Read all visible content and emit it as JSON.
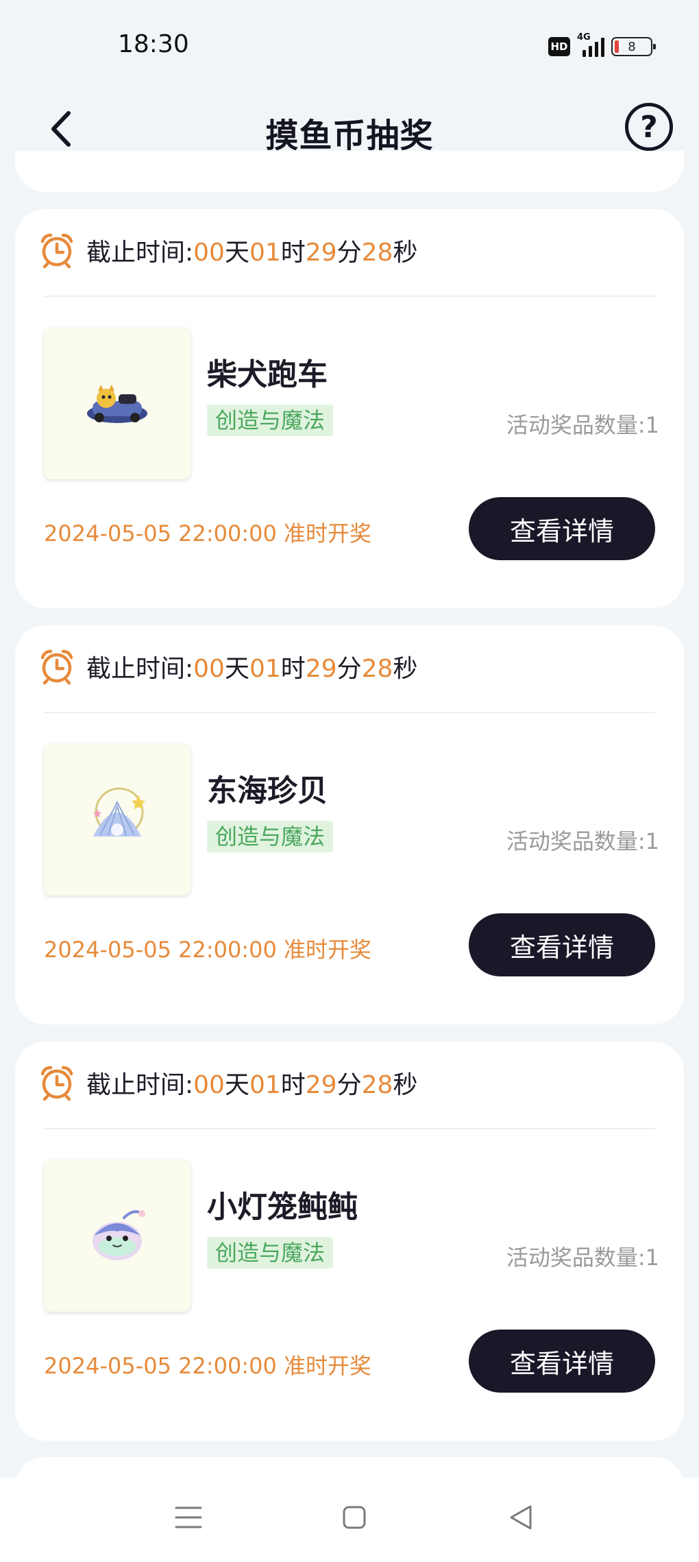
{
  "status_bar": {
    "time": "18:30",
    "hd_label": "HD",
    "network": "4G",
    "battery": "8"
  },
  "header": {
    "title": "摸鱼币抽奖",
    "back_icon": "chevron-left-icon",
    "help_icon": "question-circle-icon",
    "help_glyph": "?"
  },
  "colors": {
    "accent_orange": "#e68a3a",
    "button_dark": "#191828",
    "tag_green": "#4aa75c",
    "tag_bg": "#e0f3df"
  },
  "cards": [
    {
      "deadline_label": "截止时间:",
      "days": "00",
      "days_unit": "天",
      "hours": "01",
      "hours_unit": "时",
      "minutes": "29",
      "minutes_unit": "分",
      "seconds": "28",
      "seconds_unit": "秒",
      "prize_name": "柴犬跑车",
      "category": "创造与魔法",
      "prize_count": "活动奖品数量:1",
      "draw_time": "2024-05-05 22:00:00 准时开奖",
      "button_label": "查看详情",
      "image_icon": "shiba-car-icon"
    },
    {
      "deadline_label": "截止时间:",
      "days": "00",
      "days_unit": "天",
      "hours": "01",
      "hours_unit": "时",
      "minutes": "29",
      "minutes_unit": "分",
      "seconds": "28",
      "seconds_unit": "秒",
      "prize_name": "东海珍贝",
      "category": "创造与魔法",
      "prize_count": "活动奖品数量:1",
      "draw_time": "2024-05-05 22:00:00 准时开奖",
      "button_label": "查看详情",
      "image_icon": "pearl-shell-icon"
    },
    {
      "deadline_label": "截止时间:",
      "days": "00",
      "days_unit": "天",
      "hours": "01",
      "hours_unit": "时",
      "minutes": "29",
      "minutes_unit": "分",
      "seconds": "28",
      "seconds_unit": "秒",
      "prize_name": "小灯笼鲀鲀",
      "category": "创造与魔法",
      "prize_count": "活动奖品数量:1",
      "draw_time": "2024-05-05 22:00:00 准时开奖",
      "button_label": "查看详情",
      "image_icon": "lantern-puffer-icon"
    }
  ],
  "system_nav": {
    "menu_icon": "menu-icon",
    "home_icon": "home-square-icon",
    "back_icon": "back-triangle-icon"
  }
}
